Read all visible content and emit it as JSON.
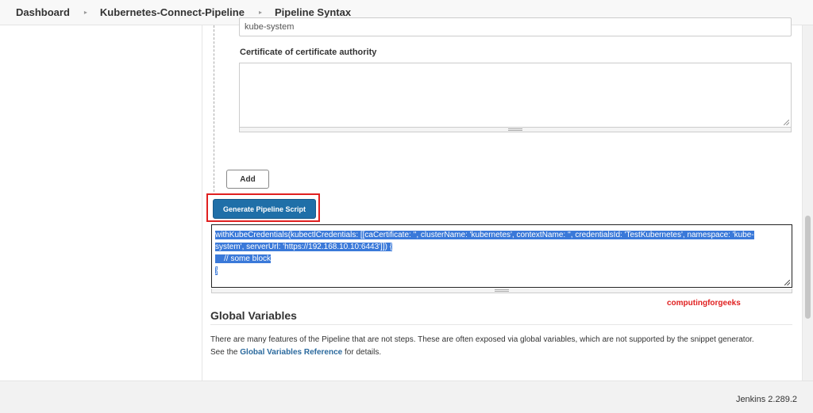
{
  "breadcrumb": {
    "items": [
      {
        "label": "Dashboard"
      },
      {
        "label": "Kubernetes-Connect-Pipeline"
      },
      {
        "label": "Pipeline Syntax"
      }
    ],
    "separator": "▸"
  },
  "form": {
    "namespace_value": "kube-system",
    "certificate_label": "Certificate of certificate authority",
    "certificate_value": "",
    "add_label": "Add"
  },
  "generator": {
    "button_label": "Generate Pipeline Script",
    "script_lines": [
      "withKubeCredentials(kubectlCredentials: [[caCertificate: '', clusterName: 'kubernetes', contextName: '', credentialsId: 'TestKubernetes', namespace: 'kube-",
      "system', serverUrl: 'https://192.168.10.10:6443']]) {",
      "    // some block",
      "}"
    ]
  },
  "watermark": "computingforgeeks",
  "global_variables": {
    "title": "Global Variables",
    "text_part1": "There are many features of the Pipeline that are not steps. These are often exposed via global variables, which are not supported by the snippet generator.",
    "text_part2": "See the",
    "link_label": "Global Variables Reference",
    "text_part3": "for details."
  },
  "footer": {
    "version": "Jenkins 2.289.2"
  },
  "colors": {
    "primary_button": "#1f6fa8",
    "highlight_border": "#e02020",
    "selection": "#3a79d9",
    "link": "#2b6a9e"
  }
}
